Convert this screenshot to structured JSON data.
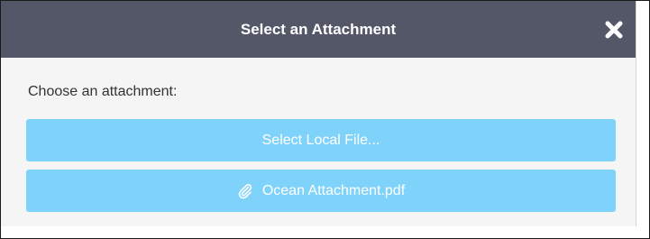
{
  "dialog": {
    "title": "Select an Attachment",
    "close_icon": "close-x-icon",
    "prompt": "Choose an attachment:",
    "buttons": {
      "local_file_label": "Select Local File...",
      "attachment_label": "Ocean Attachment.pdf",
      "attachment_icon": "paperclip-icon"
    }
  },
  "colors": {
    "header_bg": "#535767",
    "button_bg": "#7fd3fb",
    "dialog_bg": "#f5f5f5"
  }
}
